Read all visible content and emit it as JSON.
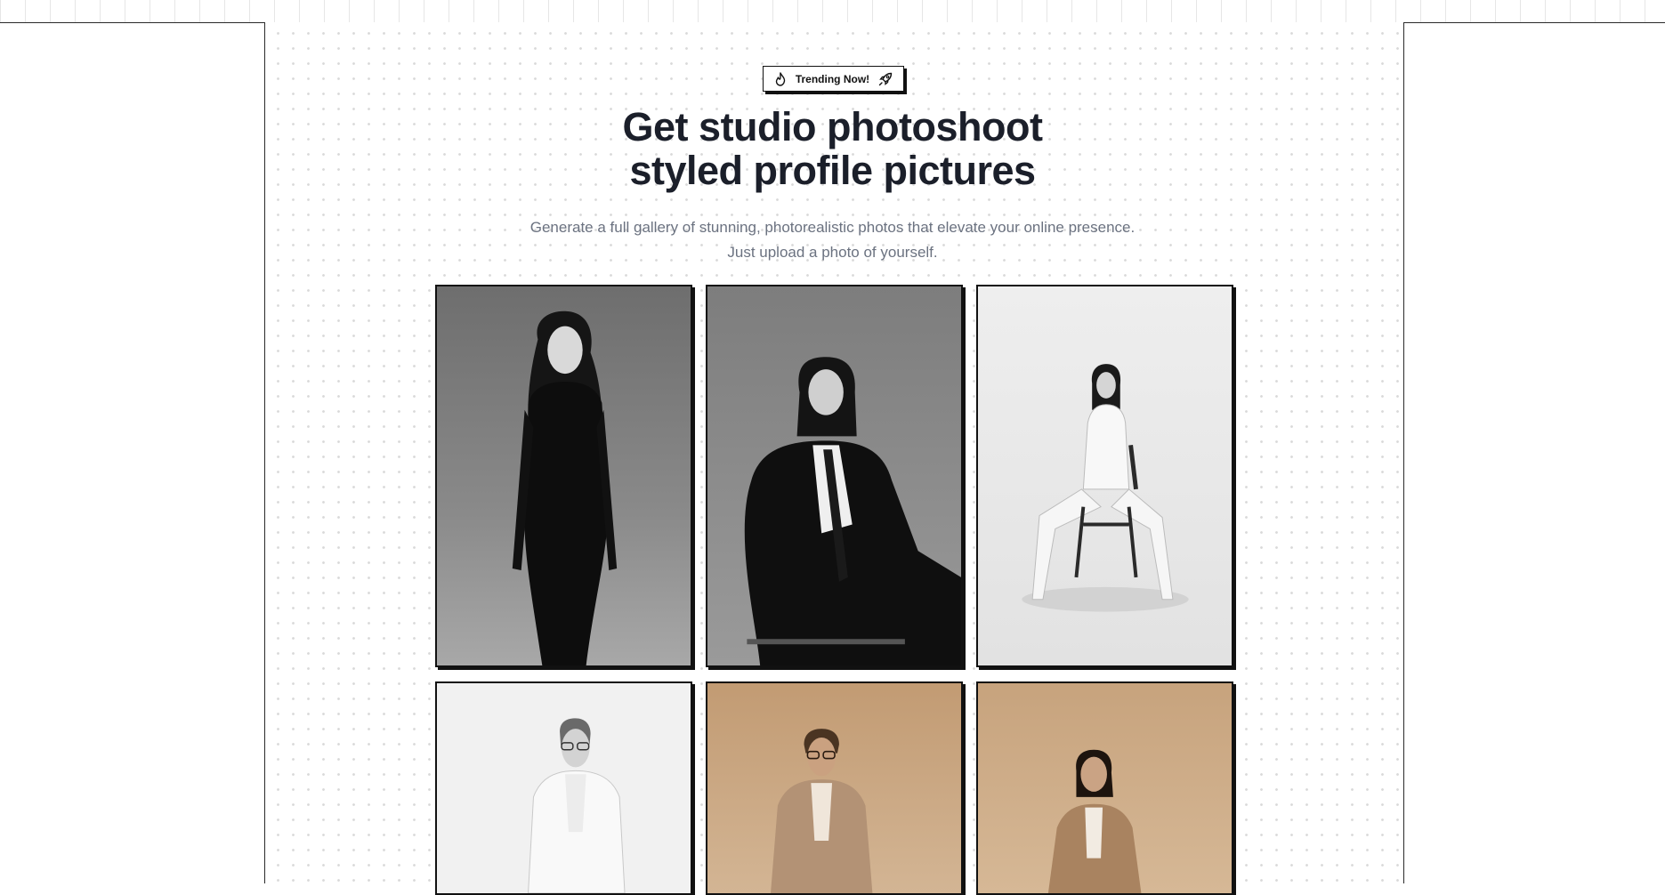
{
  "badge": {
    "label": "Trending Now!",
    "left_icon": "flame-icon",
    "right_icon": "rocket-icon"
  },
  "hero": {
    "title_line1": "Get studio photoshoot",
    "title_line2": "styled profile pictures",
    "subtitle_line1": "Generate a full gallery of stunning, photorealistic photos that elevate your online presence.",
    "subtitle_line2": "Just upload a photo of yourself."
  },
  "gallery": [
    {
      "subject": "woman in black dress",
      "tone": "grayscale-dark"
    },
    {
      "subject": "woman in black suit seated",
      "tone": "grayscale-dark"
    },
    {
      "subject": "woman in white suit on chair",
      "tone": "grayscale-light"
    },
    {
      "subject": "man in white blazer",
      "tone": "grayscale-light"
    },
    {
      "subject": "man in beige suit with glasses",
      "tone": "beige"
    },
    {
      "subject": "woman in beige blazer",
      "tone": "beige"
    }
  ],
  "colors": {
    "title": "#1b1f2a",
    "subtitle": "#6b7280",
    "border": "#111111",
    "beige_bg": "#c8a580"
  }
}
